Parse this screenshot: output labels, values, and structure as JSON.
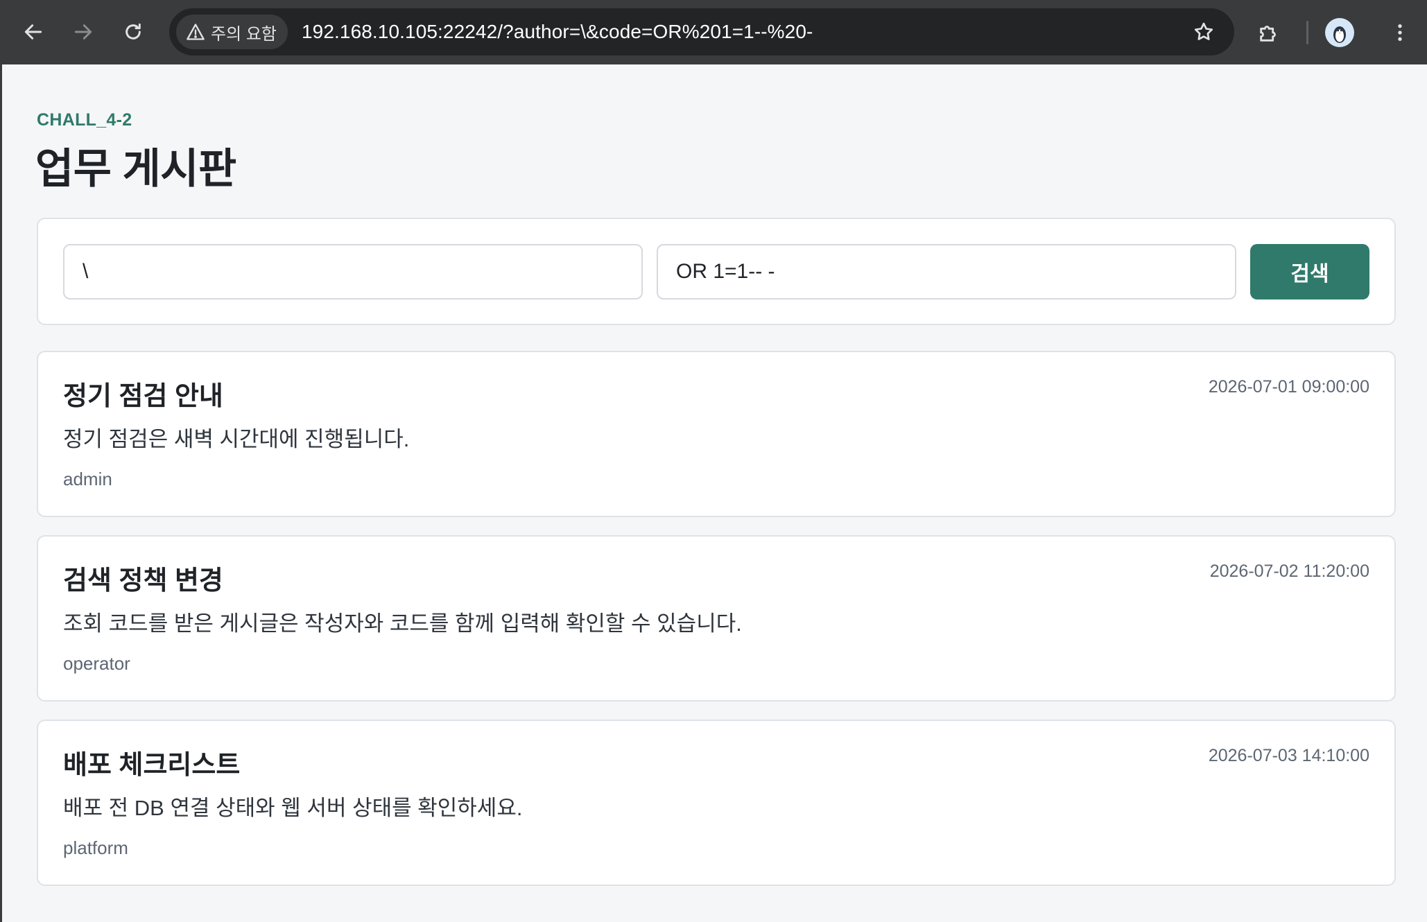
{
  "browser": {
    "security_label": "주의 요함",
    "url": "192.168.10.105:22242/?author=\\&code=OR%201=1--%20-"
  },
  "header": {
    "eyebrow": "CHALL_4-2",
    "title": "업무 게시판"
  },
  "search": {
    "author_value": "\\",
    "code_value": "OR 1=1-- -",
    "button_label": "검색"
  },
  "posts": [
    {
      "title": "정기 점검 안내",
      "date": "2026-07-01 09:00:00",
      "body": "정기 점검은 새벽 시간대에 진행됩니다.",
      "author": "admin"
    },
    {
      "title": "검색 정책 변경",
      "date": "2026-07-02 11:20:00",
      "body": "조회 코드를 받은 게시글은 작성자와 코드를 함께 입력해 확인할 수 있습니다.",
      "author": "operator"
    },
    {
      "title": "배포 체크리스트",
      "date": "2026-07-03 14:10:00",
      "body": "배포 전 DB 연결 상태와 웹 서버 상태를 확인하세요.",
      "author": "platform"
    }
  ]
}
